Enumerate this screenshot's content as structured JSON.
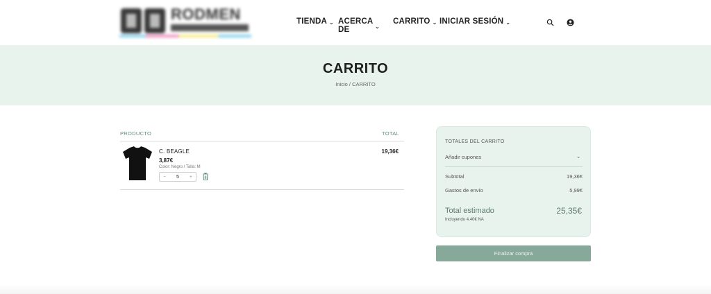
{
  "header": {
    "logo_text": "RODMEN",
    "logo_sub": "ROTULACIONES",
    "nav": [
      {
        "label": "TIENDA"
      },
      {
        "label": "ACERCA DE"
      },
      {
        "label": "CARRITO"
      },
      {
        "label": "INICIAR SESIÓN"
      }
    ],
    "icons": [
      "search-icon",
      "user-icon"
    ]
  },
  "hero": {
    "title": "CARRITO",
    "breadcrumb_home": "Inicio",
    "breadcrumb_sep": " / ",
    "breadcrumb_current": "CARRITO",
    "bg_color": "#e8f3ee"
  },
  "cart": {
    "col_product": "PRODUCTO",
    "col_total": "TOTAL",
    "items": [
      {
        "name": "C. BEAGLE",
        "price": "3,87€",
        "meta": "Color: Negro / Talla: M",
        "qty": "5",
        "minus": "−",
        "plus": "+",
        "total": "19,36€"
      }
    ]
  },
  "totals": {
    "title": "TOTALES DEL CARRITO",
    "coupon_label": "Añadir cupones",
    "subtotal_label": "Subtotal",
    "subtotal_value": "19,36€",
    "shipping_label": "Gastos de envío",
    "shipping_value": "5,99€",
    "total_label": "Total estimado",
    "total_value": "25,35€",
    "tax_note": "Incluyendo 4,40€ NA"
  },
  "checkout": {
    "label": "Finalizar compra",
    "color": "#86a99a"
  }
}
